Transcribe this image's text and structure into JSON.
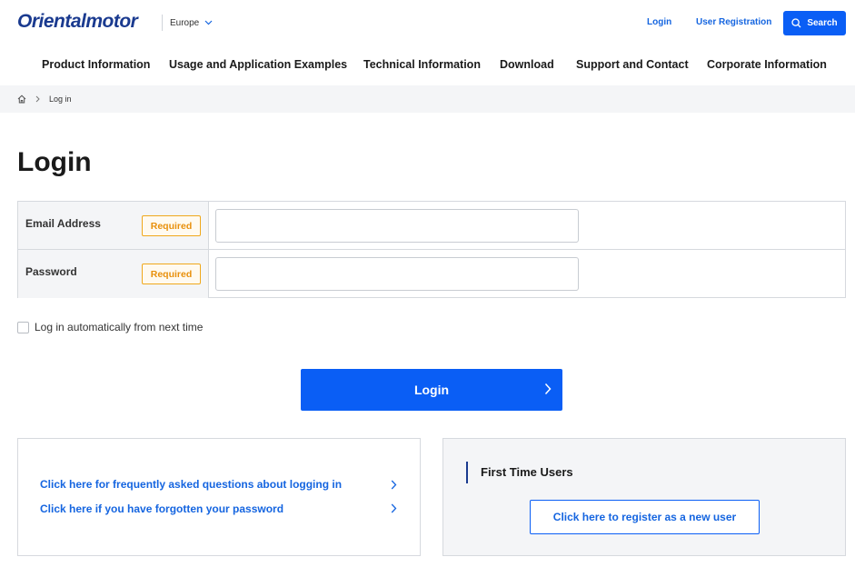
{
  "header": {
    "logo": "Orientalmotor",
    "region": "Europe",
    "login_link": "Login",
    "register_link": "User Registration",
    "search_label": "Search"
  },
  "nav": {
    "items": [
      "Product Information",
      "Usage and Application Examples",
      "Technical Information",
      "Download",
      "Support and Contact",
      "Corporate Information"
    ]
  },
  "breadcrumb": {
    "home_icon": "home-icon",
    "current": "Log in"
  },
  "page": {
    "title": "Login"
  },
  "form": {
    "email_label": "Email Address",
    "password_label": "Password",
    "required_badge": "Required",
    "email_value": "",
    "password_value": "",
    "auto_login_label": "Log in automatically from next time",
    "auto_login_checked": false,
    "submit_label": "Login"
  },
  "help": {
    "faq_link": "Click here for frequently asked questions about logging in",
    "forgot_link": "Click here if you have forgotten your password"
  },
  "first_time": {
    "title": "First Time Users",
    "register_button": "Click here to register as a new user"
  },
  "colors": {
    "primary": "#0a5ef5",
    "link": "#1565e0",
    "logo": "#1a3a8f",
    "required": "#e8900c",
    "panel_bg": "#f4f5f7"
  }
}
